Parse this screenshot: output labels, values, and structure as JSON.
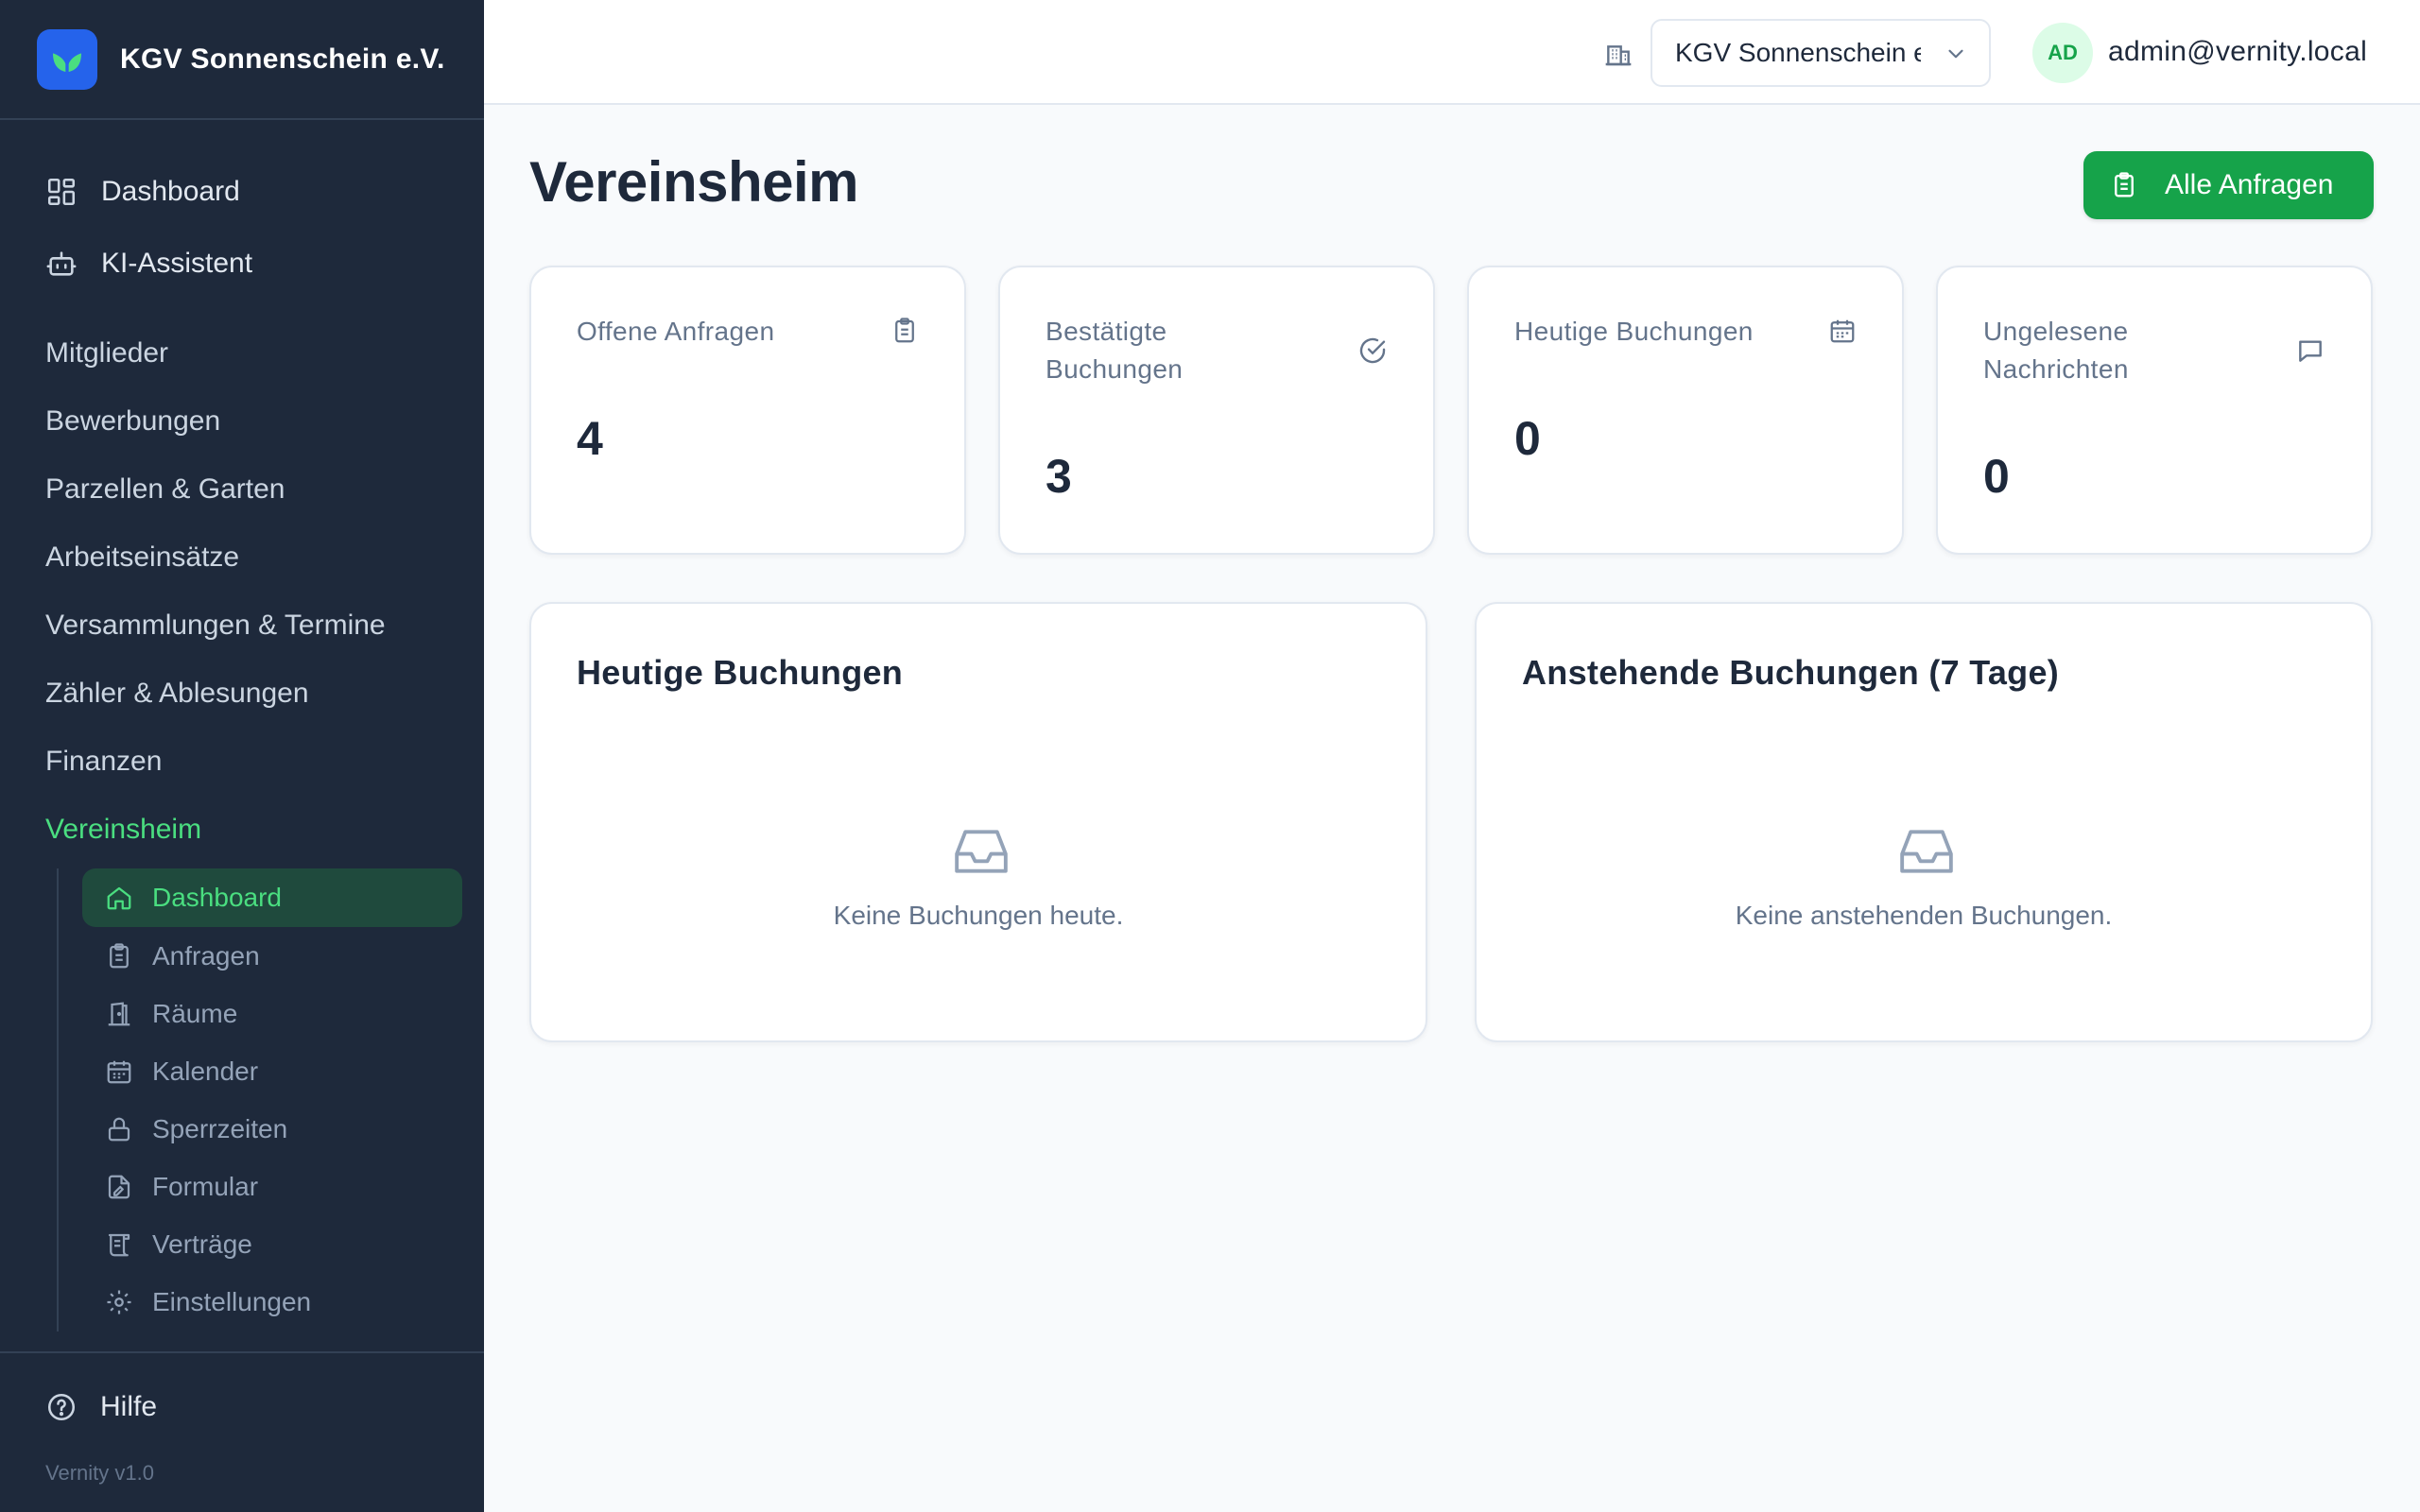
{
  "sidebar": {
    "brand_name": "KGV Sonnenschein e.V.",
    "top_items": [
      {
        "label": "Dashboard",
        "icon": "dashboard-icon"
      },
      {
        "label": "KI-Assistent",
        "icon": "bot-icon"
      }
    ],
    "sections": [
      {
        "label": "Mitglieder"
      },
      {
        "label": "Bewerbungen"
      },
      {
        "label": "Parzellen & Garten"
      },
      {
        "label": "Arbeitseinsätze"
      },
      {
        "label": "Versammlungen & Termine"
      },
      {
        "label": "Zähler & Ablesungen"
      },
      {
        "label": "Finanzen"
      },
      {
        "label": "Vereinsheim",
        "active": true
      }
    ],
    "sub_items": [
      {
        "label": "Dashboard",
        "icon": "home-icon",
        "active": true
      },
      {
        "label": "Anfragen",
        "icon": "clipboard-icon"
      },
      {
        "label": "Räume",
        "icon": "door-icon"
      },
      {
        "label": "Kalender",
        "icon": "calendar-icon"
      },
      {
        "label": "Sperrzeiten",
        "icon": "lock-icon"
      },
      {
        "label": "Formular",
        "icon": "file-edit-icon"
      },
      {
        "label": "Verträge",
        "icon": "scroll-icon"
      },
      {
        "label": "Einstellungen",
        "icon": "gear-icon"
      }
    ],
    "help_label": "Hilfe",
    "version": "Vernity v1.0"
  },
  "topbar": {
    "org_select_value": "KGV Sonnenschein e.V.",
    "avatar_initials": "AD",
    "user_email": "admin@vernity.local"
  },
  "main": {
    "title": "Vereinsheim",
    "primary_button": "Alle Anfragen",
    "stats": [
      {
        "label": "Offene Anfragen",
        "value": "4",
        "icon": "clipboard-icon"
      },
      {
        "label": "Bestätigte Buchungen",
        "value": "3",
        "icon": "check-circle-icon"
      },
      {
        "label": "Heutige Buchungen",
        "value": "0",
        "icon": "calendar-icon"
      },
      {
        "label": "Ungelesene Nachrichten",
        "value": "0",
        "icon": "message-icon"
      }
    ],
    "panels": [
      {
        "title": "Heutige Buchungen",
        "empty_text": "Keine Buchungen heute.",
        "icon": "inbox-icon"
      },
      {
        "title": "Anstehende Buchungen (7 Tage)",
        "empty_text": "Keine anstehenden Buchungen.",
        "icon": "inbox-icon"
      }
    ]
  },
  "colors": {
    "sidebar_bg": "#1e293b",
    "accent_green": "#16a34a",
    "active_green": "#4ade80",
    "brand_blue": "#2563eb"
  }
}
